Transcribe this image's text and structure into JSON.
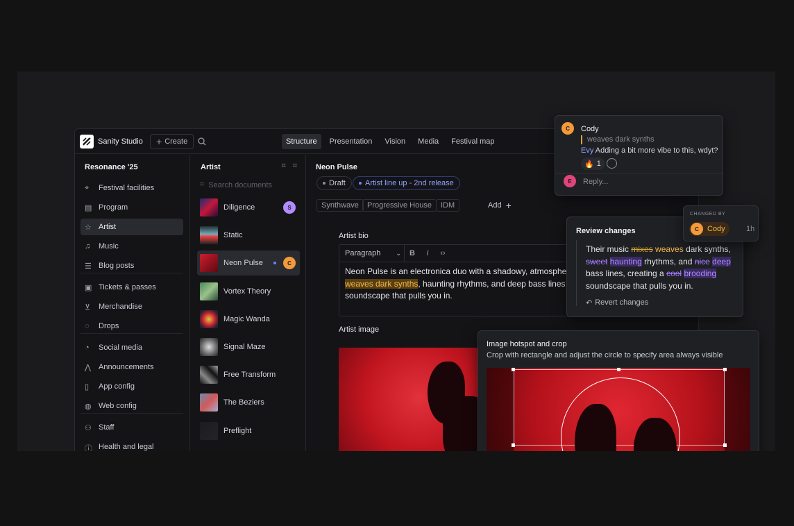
{
  "app": {
    "name": "Sanity Studio",
    "create_label": "Create",
    "nav_tabs": [
      "Structure",
      "Presentation",
      "Vision",
      "Media",
      "Festival map"
    ],
    "active_tab": "Structure"
  },
  "sidebar": {
    "title": "Resonance '25",
    "items": [
      {
        "label": "Festival facilities",
        "icon": "pin-icon"
      },
      {
        "label": "Program",
        "icon": "table-icon"
      },
      {
        "label": "Artist",
        "icon": "star-icon",
        "active": true
      },
      {
        "label": "Music",
        "icon": "music-icon"
      },
      {
        "label": "Blog posts",
        "icon": "list-icon"
      },
      {
        "label": "Tickets & passes",
        "icon": "ticket-icon"
      },
      {
        "label": "Merchandise",
        "icon": "cart-icon"
      },
      {
        "label": "Drops",
        "icon": "drop-icon"
      },
      {
        "label": "Social media",
        "icon": "bell-icon"
      },
      {
        "label": "Announcements",
        "icon": "activity-icon"
      },
      {
        "label": "App config",
        "icon": "mobile-icon"
      },
      {
        "label": "Web config",
        "icon": "globe-icon"
      },
      {
        "label": "Staff",
        "icon": "users-icon"
      },
      {
        "label": "Health and legal",
        "icon": "info-icon"
      }
    ]
  },
  "artists": {
    "title": "Artist",
    "search_placeholder": "Search documents",
    "items": [
      {
        "name": "Diligence",
        "avatar": "S",
        "avatar_color": "#b18cff"
      },
      {
        "name": "Static"
      },
      {
        "name": "Neon Pulse",
        "avatar": "C",
        "avatar_color": "#f49a3b",
        "active": true
      },
      {
        "name": "Vortex Theory"
      },
      {
        "name": "Magic Wanda"
      },
      {
        "name": "Signal Maze"
      },
      {
        "name": "Free Transform"
      },
      {
        "name": "The Beziers"
      },
      {
        "name": "Preflight"
      }
    ]
  },
  "document": {
    "title": "Neon Pulse",
    "status_draft": "Draft",
    "release": "Artist line up - 2nd release",
    "genres": [
      "Synthwave",
      "Progressive House",
      "IDM"
    ],
    "add_label": "Add",
    "bio_label": "Artist bio",
    "paragraph_style": "Paragraph",
    "bio_line1": "Neon Pulse is an electronica duo with a shadowy, atmosphe",
    "bio_highlight": "weaves dark synths",
    "bio_line2_rest": ", haunting rhythms, and deep bass lines",
    "bio_line3": "soundscape that pulls you in.",
    "image_label": "Artist image"
  },
  "comment": {
    "author": "Cody",
    "author_initial": "C",
    "quote": "weaves dark synths",
    "mention": "Evy",
    "text": "Adding a bit more vibe to this, wdyt?",
    "reaction_count": "1",
    "reply_initial": "E",
    "reply_placeholder": "Reply..."
  },
  "changed_by": {
    "heading": "CHANGED BY",
    "name": "Cody",
    "initial": "C",
    "time": "1h"
  },
  "review": {
    "title": "Review changes",
    "w1": "Their music",
    "del1": "mixes",
    "ins1": "weaves",
    "w2": "dark synths,",
    "del2": "sweet",
    "ins2": "haunting",
    "w3": "rhythms, and",
    "del3": "nice",
    "ins3": "deep",
    "w4": "bass lines, creating a",
    "del4": "cool",
    "ins4": "brooding",
    "w5": "soundscape that pulls you in.",
    "revert_label": "Revert changes"
  },
  "hotspot": {
    "title": "Image hotspot and crop",
    "subtitle": "Crop with rectangle and adjust the circle to specify area always visible"
  }
}
